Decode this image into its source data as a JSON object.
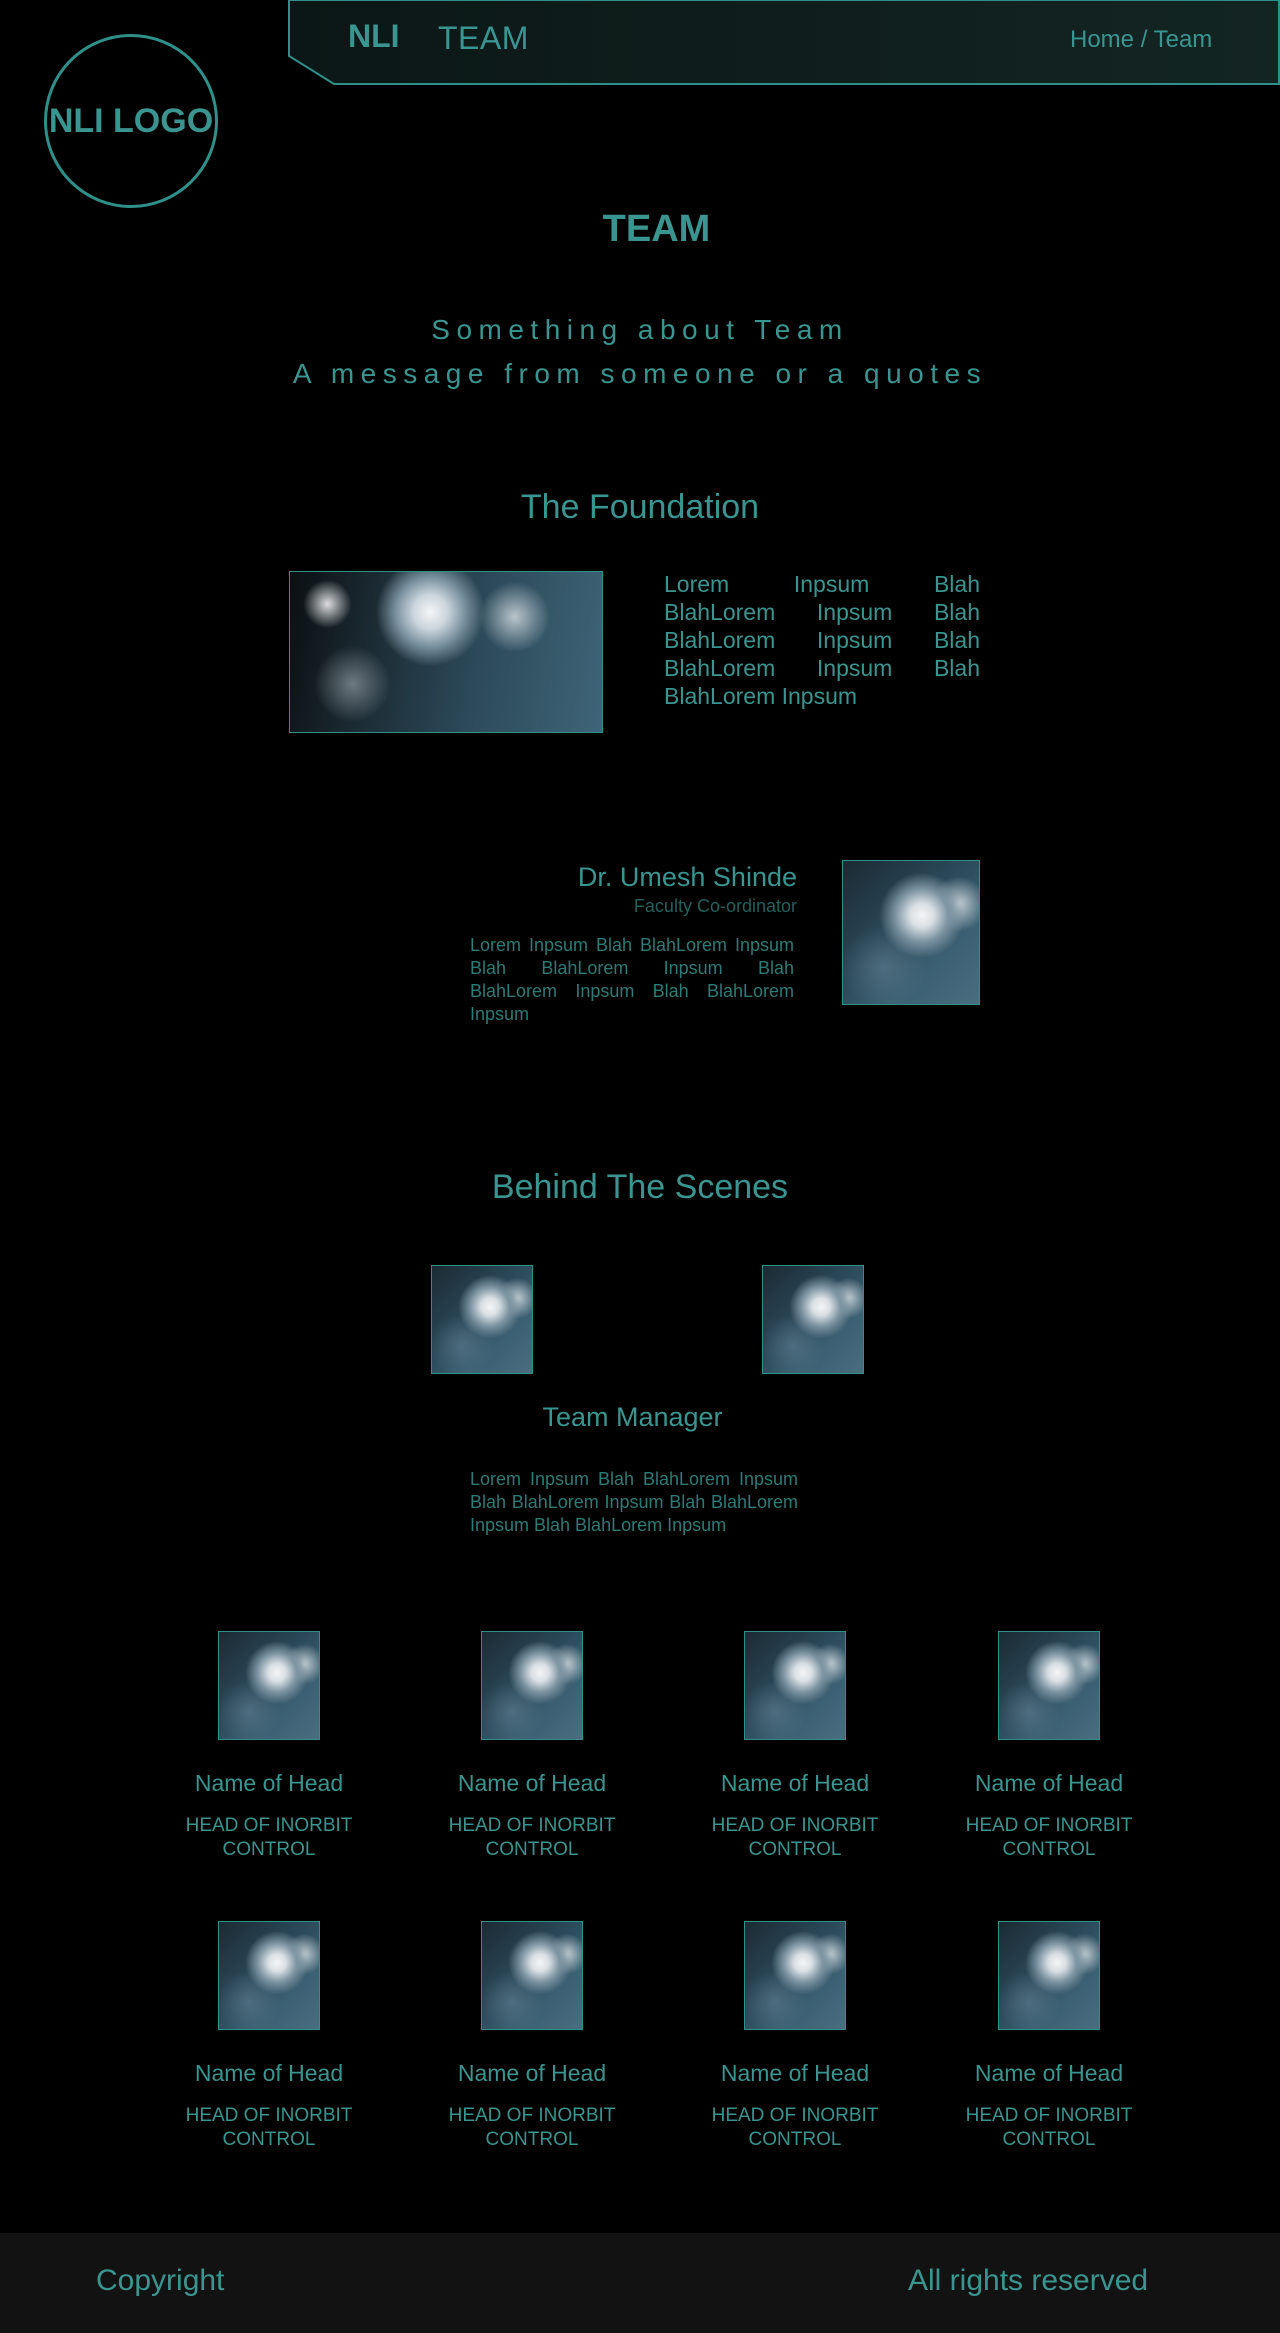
{
  "header": {
    "logo": "NLI LOGO",
    "brand": "NLI",
    "section": "TEAM",
    "breadcrumb": "Home / Team"
  },
  "page": {
    "title": "TEAM",
    "intro_line1": "Something about Team",
    "intro_line2": "A message from someone or a quotes"
  },
  "foundation": {
    "title": "The Foundation",
    "text": "Lorem Inpsum Blah BlahLorem Inpsum Blah BlahLorem Inpsum Blah BlahLorem Inpsum Blah BlahLorem Inpsum"
  },
  "coordinator": {
    "name": "Dr. Umesh Shinde",
    "role": "Faculty Co-ordinator",
    "bio": "Lorem Inpsum Blah BlahLorem Inpsum Blah BlahLorem Inpsum Blah BlahLorem Inpsum Blah BlahLorem Inpsum"
  },
  "behind": {
    "title": "Behind The Scenes",
    "manager_title": "Team Manager",
    "manager_bio": "Lorem Inpsum Blah BlahLorem Inpsum Blah BlahLorem Inpsum Blah BlahLorem Inpsum Blah BlahLorem Inpsum"
  },
  "heads": [
    {
      "name": "Name of Head",
      "role_line1": "HEAD OF INORBIT",
      "role_line2": "CONTROL"
    },
    {
      "name": "Name of Head",
      "role_line1": "HEAD OF INORBIT",
      "role_line2": "CONTROL"
    },
    {
      "name": "Name of Head",
      "role_line1": "HEAD OF INORBIT",
      "role_line2": "CONTROL"
    },
    {
      "name": "Name of Head",
      "role_line1": "HEAD OF INORBIT",
      "role_line2": "CONTROL"
    },
    {
      "name": "Name of Head",
      "role_line1": "HEAD OF INORBIT",
      "role_line2": "CONTROL"
    },
    {
      "name": "Name of Head",
      "role_line1": "HEAD OF INORBIT",
      "role_line2": "CONTROL"
    },
    {
      "name": "Name of Head",
      "role_line1": "HEAD OF INORBIT",
      "role_line2": "CONTROL"
    },
    {
      "name": "Name of Head",
      "role_line1": "HEAD OF INORBIT",
      "role_line2": "CONTROL"
    }
  ],
  "footer": {
    "left": "Copyright",
    "right": "All rights reserved"
  },
  "colors": {
    "accent": "#3a9590",
    "background": "#000000",
    "footer_bg": "#121212"
  }
}
